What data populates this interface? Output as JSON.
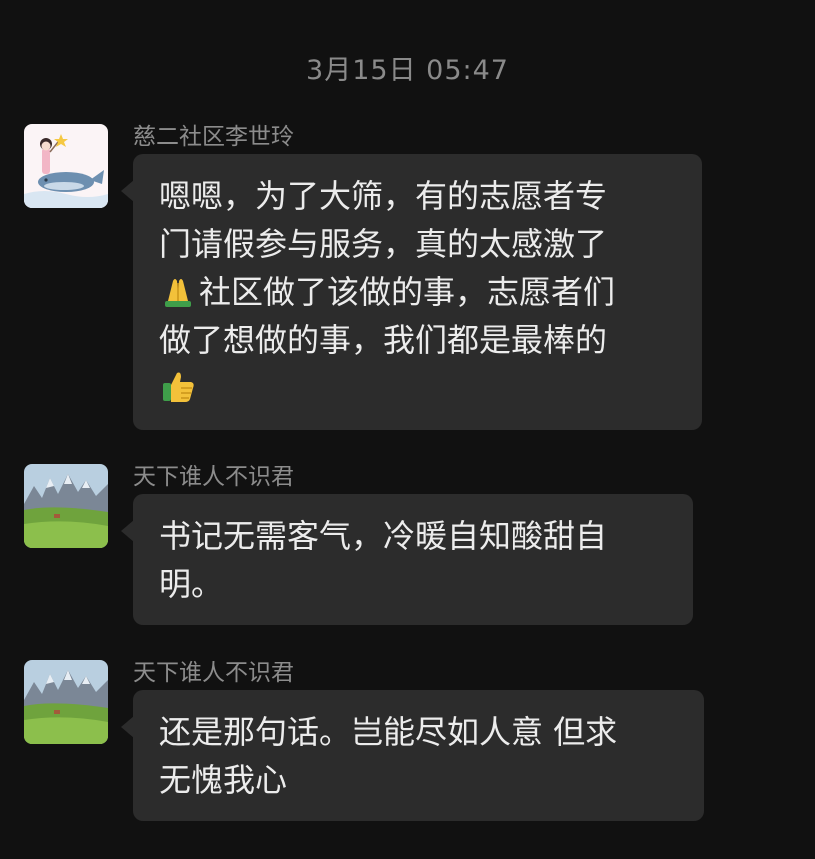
{
  "timestamp": "3月15日 05:47",
  "messages": [
    {
      "sender": "慈二社区李世玲",
      "avatar_icon": "girl-on-whale-avatar",
      "lines": [
        "嗯嗯，为了大筛，有的志愿者专",
        "门请假参与服务，真的太感激了",
        "社区做了该做的事，志愿者们",
        "做了想做的事，我们都是最棒的"
      ],
      "emojis": [
        "folded-hands-emoji",
        "thumbs-up-emoji"
      ]
    },
    {
      "sender": "天下谁人不识君",
      "avatar_icon": "mountain-meadow-avatar",
      "lines": [
        "书记无需客气，冷暖自知酸甜自",
        "明。"
      ]
    },
    {
      "sender": "天下谁人不识君",
      "avatar_icon": "mountain-meadow-avatar",
      "lines": [
        "还是那句话。岂能尽如人意 但求",
        "无愧我心"
      ]
    }
  ],
  "colors": {
    "background": "#111111",
    "bubble": "#2c2c2c",
    "text": "#ececec",
    "meta": "#8a8a8a"
  }
}
